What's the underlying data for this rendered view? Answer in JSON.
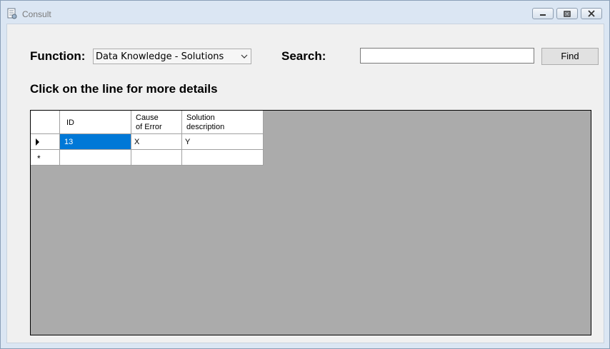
{
  "window": {
    "title": "Consult",
    "accent": "#0078d7"
  },
  "form": {
    "function_label": "Function:",
    "function_value": "Data Knowledge - Solutions",
    "search_label": "Search:",
    "search_value": "",
    "find_label": "Find",
    "instruction": "Click on the line for more details"
  },
  "grid": {
    "columns": [
      "ID",
      "Cause\nof Error",
      "Solution\ndescription"
    ],
    "rows": [
      {
        "id": "13",
        "cause": "X",
        "solution": "Y"
      }
    ],
    "new_row_marker": "*"
  }
}
